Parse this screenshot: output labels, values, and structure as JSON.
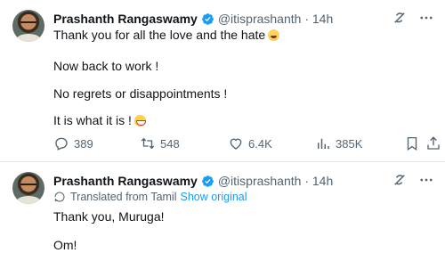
{
  "tweets": [
    {
      "author_name": "Prashanth Rangaswamy",
      "handle_time": "@itisprashanth · 14h",
      "lines": [
        "Thank you for all the love and the hate",
        "Now back to work !",
        "No regrets or disappointments !",
        "It is what it is !"
      ],
      "emoji_line1": "wink-emoji",
      "emoji_line4": "grin-emoji",
      "actions": {
        "replies": "389",
        "reposts": "548",
        "likes": "6.4K",
        "views": "385K"
      }
    },
    {
      "author_name": "Prashanth Rangaswamy",
      "handle_time": "@itisprashanth · 14h",
      "translated_label": "Translated from Tamil",
      "show_original": "Show original",
      "lines": [
        "Thank you, Muruga!",
        "Om!"
      ]
    }
  ],
  "icons": {
    "verified": "verified-badge-icon",
    "grok": "grok-icon",
    "more": "more-icon",
    "reply": "reply-icon",
    "repost": "repost-icon",
    "like": "like-icon",
    "views": "views-icon",
    "bookmark": "bookmark-icon",
    "share": "share-icon",
    "translate": "translate-icon"
  },
  "colors": {
    "accent": "#1d9bf0",
    "secondary_text": "#536471",
    "primary_text": "#0f1419"
  }
}
